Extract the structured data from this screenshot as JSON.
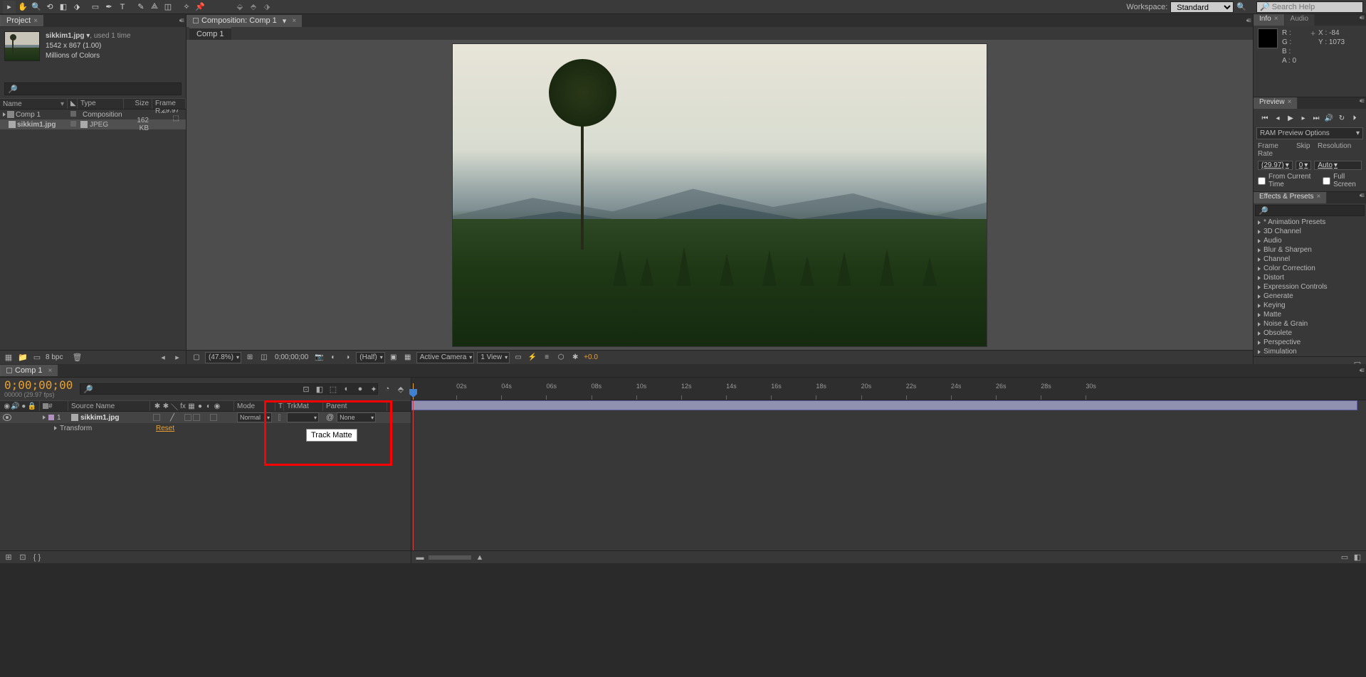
{
  "toolbar": {
    "workspace_label": "Workspace:",
    "workspace_value": "Standard",
    "search_placeholder": "Search Help"
  },
  "project": {
    "title": "Project",
    "asset": {
      "name": "sikkim1.jpg",
      "used": ", used 1 time",
      "dims": "1542 x 867 (1.00)",
      "colors": "Millions of Colors"
    },
    "search_placeholder": "",
    "columns": {
      "name": "Name",
      "type": "Type",
      "size": "Size",
      "frame_rate": "Frame R..."
    },
    "items": [
      {
        "name": "Comp 1",
        "type": "Composition",
        "size": "",
        "fr": "29.97"
      },
      {
        "name": "sikkim1.jpg",
        "type": "JPEG",
        "size": "162 KB",
        "fr": ""
      }
    ],
    "bpc": "8 bpc"
  },
  "composition": {
    "panel_title": "Composition: Comp 1",
    "tab": "Comp 1",
    "footer": {
      "zoom": "(47.8%)",
      "time": "0;00;00;00",
      "res": "(Half)",
      "camera": "Active Camera",
      "view": "1 View",
      "exposure": "+0.0"
    }
  },
  "info": {
    "tab1": "Info",
    "tab2": "Audio",
    "r": "R :",
    "g": "G :",
    "b": "B :",
    "a_label": "A :",
    "a_val": "0",
    "x_label": "X :",
    "x_val": "-84",
    "y_label": "Y :",
    "y_val": "1073"
  },
  "preview": {
    "title": "Preview",
    "ram": "RAM Preview Options",
    "frame_rate_label": "Frame Rate",
    "skip_label": "Skip",
    "res_label": "Resolution",
    "frame_rate_val": "(29.97)",
    "skip_val": "0",
    "res_val": "Auto",
    "from_current": "From Current Time",
    "full_screen": "Full Screen"
  },
  "effects": {
    "title": "Effects & Presets",
    "search_placeholder": "",
    "categories": [
      "* Animation Presets",
      "3D Channel",
      "Audio",
      "Blur & Sharpen",
      "Channel",
      "Color Correction",
      "Distort",
      "Expression Controls",
      "Generate",
      "Keying",
      "Matte",
      "Noise & Grain",
      "Obsolete",
      "Perspective",
      "Simulation"
    ]
  },
  "timeline": {
    "tab": "Comp 1",
    "timecode": "0;00;00;00",
    "timecode_sub": "00000 (29.97 fps)",
    "search_placeholder": "",
    "columns": {
      "idx": "#",
      "source_name": "Source Name",
      "mode": "Mode",
      "t": "T",
      "trkmat": "TrkMat",
      "parent": "Parent"
    },
    "layer": {
      "index": "1",
      "name": "sikkim1.jpg",
      "mode": "Normal",
      "parent": "None",
      "transform": "Transform",
      "reset": "Reset"
    },
    "tooltip": "Track Matte",
    "ruler_marks": [
      "02s",
      "04s",
      "06s",
      "08s",
      "10s",
      "12s",
      "14s",
      "16s",
      "18s",
      "20s",
      "22s",
      "24s",
      "26s",
      "28s",
      "30s"
    ]
  }
}
